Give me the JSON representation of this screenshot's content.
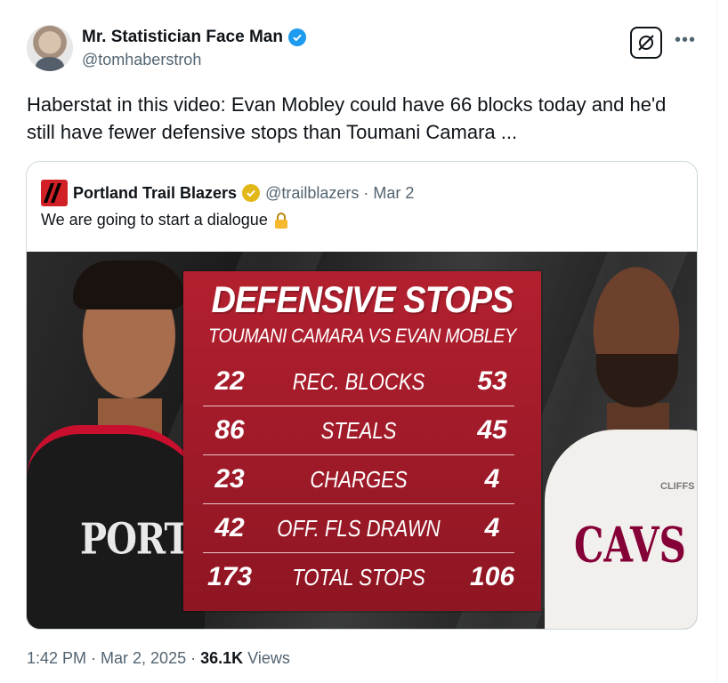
{
  "author": {
    "name": "Mr. Statistician Face Man",
    "handle": "@tomhaberstroh"
  },
  "tweet": {
    "text": "Haberstat in this video: Evan Mobley could have 66 blocks today and he'd still have fewer defensive stops than Toumani Camara ..."
  },
  "quote": {
    "name": "Portland Trail Blazers",
    "meta": "@trailblazers · Mar 2",
    "text": "We are going to start a dialogue"
  },
  "graphic": {
    "title": "DEFENSIVE STOPS",
    "subtitle": "TOUMANI CAMARA VS EVAN MOBLEY",
    "jersey_left": "PORTLA",
    "jersey_right": "CAVS",
    "sponsor": "CLIFFS",
    "rows": [
      {
        "left": "22",
        "label": "REC. BLOCKS",
        "right": "53"
      },
      {
        "left": "86",
        "label": "STEALS",
        "right": "45"
      },
      {
        "left": "23",
        "label": "CHARGES",
        "right": "4"
      },
      {
        "left": "42",
        "label": "OFF. FLS DRAWN",
        "right": "4"
      },
      {
        "left": "173",
        "label": "TOTAL STOPS",
        "right": "106"
      }
    ]
  },
  "footer": {
    "time": "1:42 PM · Mar 2, 2025 · ",
    "views_count": "36.1K",
    "views_label": " Views"
  },
  "colors": {
    "panel_red": "#b3202f",
    "verified_blue": "#1d9bf0",
    "gold_badge": "#e2b719"
  },
  "icons": [
    "verified-badge-icon",
    "grok-icon",
    "more-icon",
    "trail-blazers-logo-icon",
    "gold-verified-badge-icon",
    "lock-icon"
  ]
}
